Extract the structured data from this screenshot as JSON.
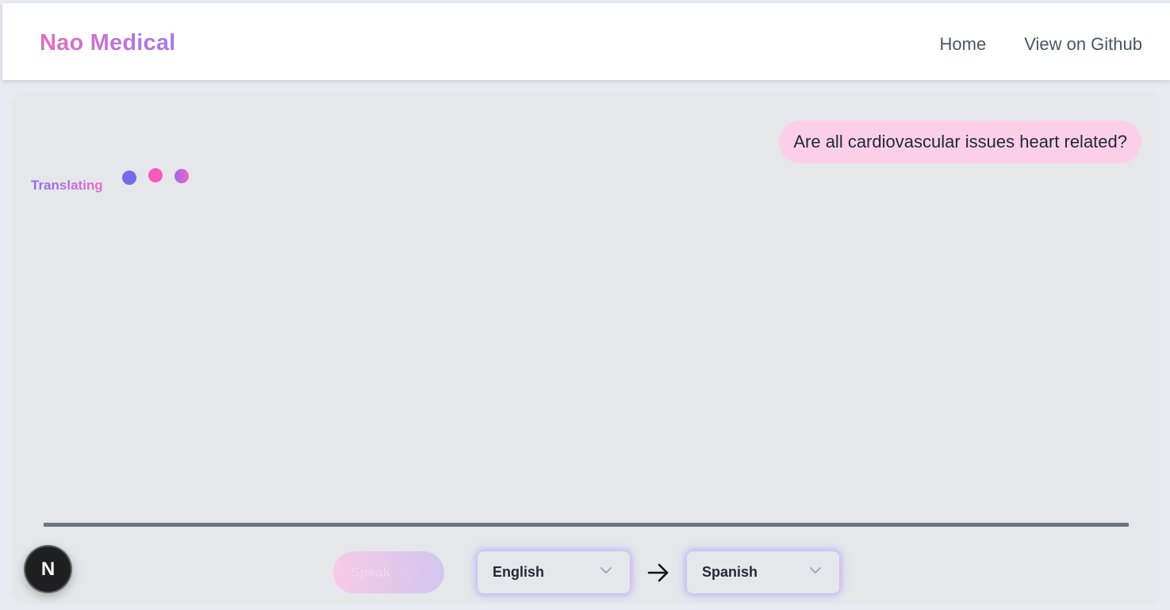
{
  "navbar": {
    "brand": "Nao Medical",
    "links": [
      {
        "label": "Home"
      },
      {
        "label": "View on Github"
      }
    ]
  },
  "chat": {
    "user_message": "Are all cardiovascular issues heart related?",
    "status_text": "Translating"
  },
  "controls": {
    "speak_label": "Speak",
    "source_language": "English",
    "target_language": "Spanish"
  },
  "dev_badge": {
    "label": "N"
  },
  "icons": {
    "mic": "microphone-icon",
    "chevron": "chevron-down-icon",
    "arrow": "arrow-right-icon"
  },
  "colors": {
    "brand_gradient_start": "#e26fc3",
    "brand_gradient_end": "#a479e6",
    "bubble_bg": "#fbcfe8",
    "panel_bg": "#e5e7eb",
    "dot_1": "#7469ec",
    "dot_2": "#f85aba",
    "divider": "#6b7280"
  }
}
